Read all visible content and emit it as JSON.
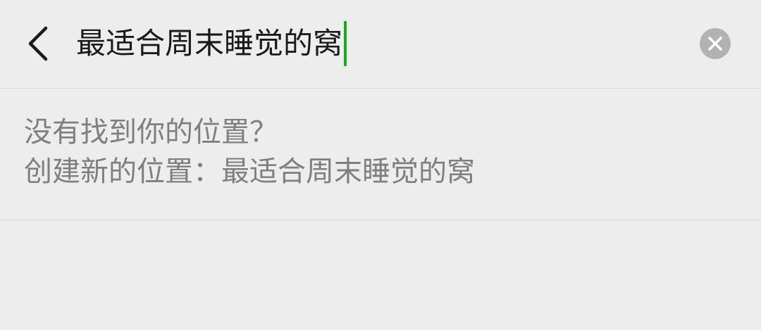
{
  "header": {
    "back_icon": "chevron-left-icon",
    "search_value": "最适合周末睡觉的窝",
    "clear_icon": "close-circle-icon"
  },
  "result": {
    "not_found_text": "没有找到你的位置？",
    "create_prefix": "创建新的位置：",
    "create_name": "最适合周末睡觉的窝"
  },
  "colors": {
    "background": "#ededed",
    "caret": "#1aad19",
    "divider": "#d6d6d6",
    "clear_button": "#b2b2b2",
    "secondary_text": "#7f7f7f"
  }
}
